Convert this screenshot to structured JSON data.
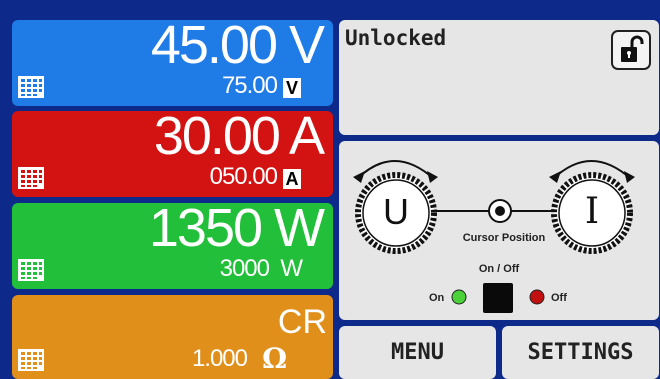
{
  "voltage": {
    "actual": "45.00 V",
    "set": "75.00",
    "unit": "V",
    "color": "#1f7be6"
  },
  "current": {
    "actual": "30.00 A",
    "set": "050.00",
    "unit": "A",
    "color": "#d31212"
  },
  "power": {
    "actual": "1350 W",
    "set": "3000",
    "unit": "W",
    "color": "#22c03a"
  },
  "resistance": {
    "mode": "CR",
    "set": "1.000",
    "unit": "Ω",
    "color": "#e0901a"
  },
  "lock": {
    "status": "Unlocked"
  },
  "control": {
    "knob_u": "U",
    "knob_i": "I",
    "cursor_label": "Cursor Position",
    "onoff_label": "On / Off",
    "on_label": "On",
    "off_label": "Off"
  },
  "buttons": {
    "menu": "MENU",
    "settings": "SETTINGS"
  }
}
